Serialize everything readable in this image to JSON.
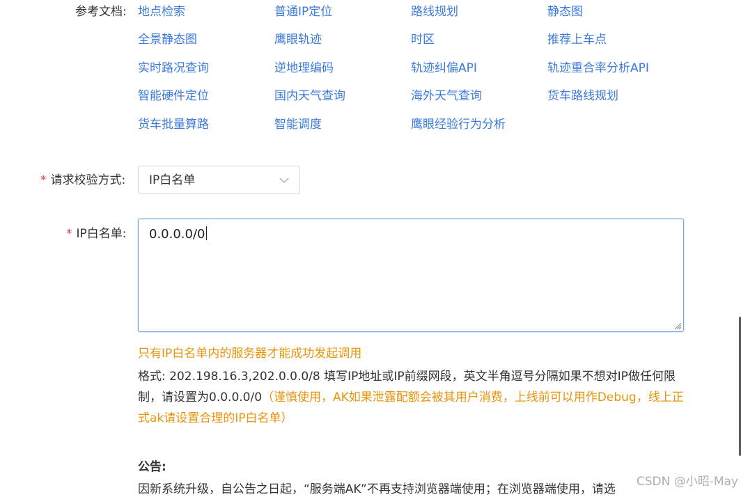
{
  "reference_docs": {
    "label": "参考文档:",
    "links": [
      "地点检索",
      "普通IP定位",
      "路线规划",
      "静态图",
      "全景静态图",
      "鹰眼轨迹",
      "时区",
      "推荐上车点",
      "实时路况查询",
      "逆地理编码",
      "轨迹纠偏API",
      "轨迹重合率分析API",
      "智能硬件定位",
      "国内天气查询",
      "海外天气查询",
      "货车路线规划",
      "货车批量算路",
      "智能调度",
      "鹰眼经验行为分析"
    ]
  },
  "form": {
    "required_mark": "*",
    "verify_method": {
      "label": "请求校验方式:",
      "value": "IP白名单"
    },
    "ip_whitelist": {
      "label": "IP白名单:",
      "value": "0.0.0.0/0"
    }
  },
  "hints": {
    "warning": "只有IP白名单内的服务器才能成功发起调用",
    "format_text": "格式: 202.198.16.3,202.0.0.0/8 填写IP地址或IP前缀网段，英文半角逗号分隔如果不想对IP做任何限制，请设置为0.0.0.0/0",
    "format_caution": "（谨慎使用，AK如果泄露配额会被其用户消费，上线前可以用作Debug，线上正式ak请设置合理的IP白名单）"
  },
  "notice": {
    "title": "公告:",
    "body": "因新系统升级，自公告之日起，“服务端AK”不再支持浏览器端使用；在浏览器端使用，请选"
  },
  "watermark": "CSDN @小昭-May",
  "colors": {
    "link": "#3c7bd9",
    "warning": "#e8940c",
    "required": "#e4393c",
    "focus_border": "#7aa3e6"
  },
  "icons": {
    "select_arrow": "chevron-down-icon",
    "textarea_resize": "resize-handle-icon"
  }
}
